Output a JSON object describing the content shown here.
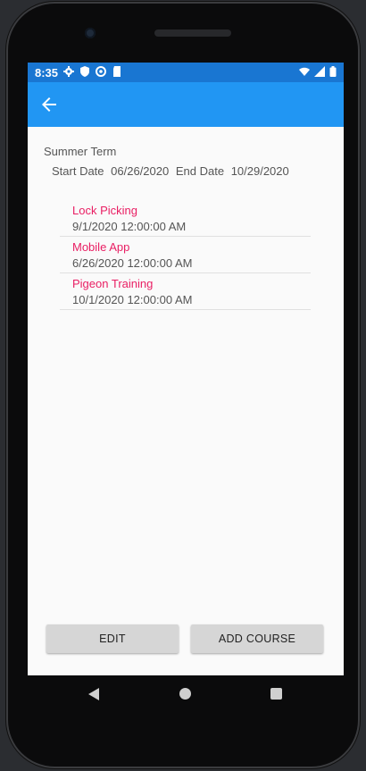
{
  "status_bar": {
    "time": "8:35",
    "left_icons": [
      "gear-icon",
      "shield-icon",
      "sync-icon",
      "sd-card-icon"
    ],
    "right_icons": [
      "wifi-icon",
      "signal-icon",
      "battery-icon"
    ]
  },
  "app_bar": {
    "back_icon": "arrow-left-icon",
    "color": "#2196f3",
    "status_color": "#1976d2"
  },
  "term": {
    "name": "Summer Term",
    "start_label": "Start Date",
    "start_value": "06/26/2020",
    "end_label": "End Date",
    "end_value": "10/29/2020"
  },
  "courses": [
    {
      "title": "Lock Picking",
      "date": "9/1/2020 12:00:00 AM"
    },
    {
      "title": "Mobile App",
      "date": "6/26/2020 12:00:00 AM"
    },
    {
      "title": "Pigeon Training",
      "date": "10/1/2020 12:00:00 AM"
    }
  ],
  "buttons": {
    "edit": "EDIT",
    "add_course": "ADD COURSE"
  },
  "accent_color": "#e91e63",
  "system_nav": [
    "back-triangle-icon",
    "home-circle-icon",
    "recents-square-icon"
  ]
}
